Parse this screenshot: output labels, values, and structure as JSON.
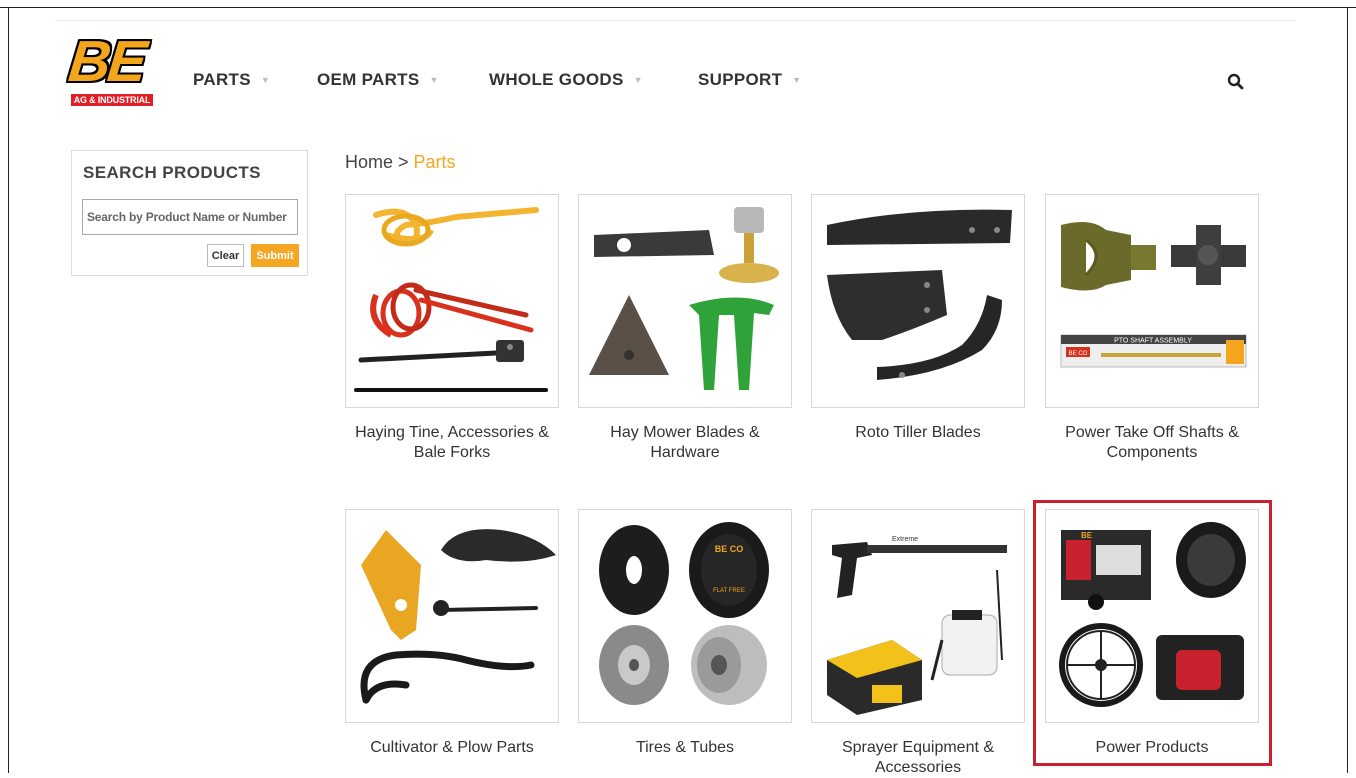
{
  "brand": {
    "logo_text": "BE",
    "logo_subtitle": "AG & INDUSTRIAL",
    "colors": {
      "brand_orange": "#f3a51c",
      "brand_red": "#e01f26",
      "accent": "#f5a623",
      "highlight": "#c8202c"
    }
  },
  "nav": {
    "items": [
      {
        "label": "PARTS",
        "icon": "caret-down-icon"
      },
      {
        "label": "OEM PARTS",
        "icon": "caret-down-icon"
      },
      {
        "label": "WHOLE GOODS",
        "icon": "caret-down-icon"
      },
      {
        "label": "SUPPORT",
        "icon": "caret-down-icon"
      }
    ],
    "search_icon": "search-icon"
  },
  "sidebar": {
    "title": "SEARCH PRODUCTS",
    "search_placeholder": "Search by Product Name or Number",
    "search_value": "",
    "clear_label": "Clear",
    "submit_label": "Submit"
  },
  "breadcrumb": {
    "home": "Home",
    "separator": ">",
    "current": "Parts"
  },
  "categories": [
    {
      "label": "Haying Tine, Accessories & Bale Forks",
      "highlighted": false
    },
    {
      "label": "Hay Mower Blades & Hardware",
      "highlighted": false
    },
    {
      "label": "Roto Tiller Blades",
      "highlighted": false
    },
    {
      "label": "Power Take Off Shafts & Components",
      "highlighted": false
    },
    {
      "label": "Cultivator & Plow Parts",
      "highlighted": false
    },
    {
      "label": "Tires & Tubes",
      "highlighted": false
    },
    {
      "label": "Sprayer Equipment & Accessories",
      "highlighted": false
    },
    {
      "label": "Power Products",
      "highlighted": true
    }
  ],
  "product_text": {
    "pto_box": "PTO SHAFT ASSEMBLY",
    "pto_brand": "BE CO",
    "tire_brand": "BE CO",
    "tire_text": "FLAT FREE",
    "sprayer_brand": "Extreme",
    "generator_brand": "BE"
  }
}
